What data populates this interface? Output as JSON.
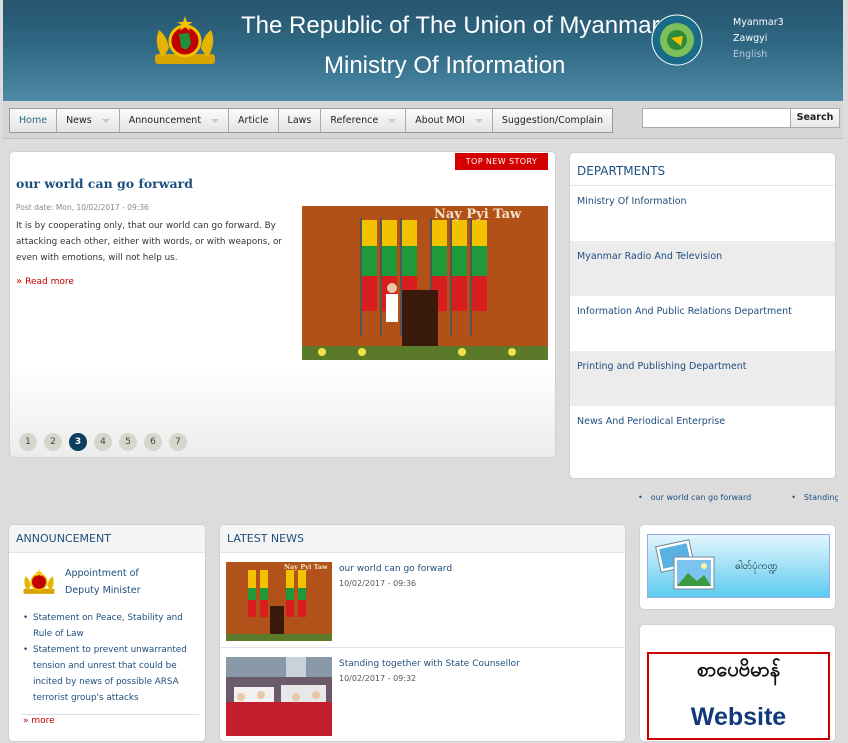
{
  "header": {
    "title_line1": "The Republic of The Union of Myanmar",
    "title_line2": "Ministry Of Information",
    "languages": [
      "Myanmar3",
      "Zawgyi",
      "English"
    ]
  },
  "nav": {
    "items": [
      {
        "label": "Home"
      },
      {
        "label": "News"
      },
      {
        "label": "Announcement"
      },
      {
        "label": "Article"
      },
      {
        "label": "Laws"
      },
      {
        "label": "Reference"
      },
      {
        "label": "About MOI"
      },
      {
        "label": "Suggestion/Complain"
      }
    ],
    "search_button": "Search",
    "search_value": ""
  },
  "featured": {
    "badge": "TOP NEW STORY",
    "title": "our world can go forward",
    "date": "Post date: Mon, 10/02/2017 - 09:36",
    "body": "It is by cooperating only, that our world can go forward. By attacking each other, either with words, or with weapons, or even with emotions, will not help us.",
    "more_arrow": "»",
    "read_more": "Read more",
    "image_caption": "Nay Pyi Taw",
    "pages": [
      "1",
      "2",
      "3",
      "4",
      "5",
      "6",
      "7"
    ],
    "current_page": "3"
  },
  "departments": {
    "heading": "DEPARTMENTS",
    "items": [
      "Ministry Of Information",
      "Myanmar Radio And Television",
      "Information And Public Relations Department",
      "Printing and Publishing Department",
      "News And Periodical Enterprise"
    ]
  },
  "ticker": [
    "our world can go forward",
    "Standing"
  ],
  "announcement": {
    "heading": "ANNOUNCEMENT",
    "feature_line1": "Appointment of",
    "feature_line2": "Deputy Minister",
    "items": [
      "Statement on Peace, Stability and Rule of Law",
      "Statement to prevent unwarranted tension and unrest that could be incited by news of possible ARSA terrorist group's attacks"
    ],
    "more": "more",
    "more_arrow": "»"
  },
  "latest_news": {
    "heading": "LATEST NEWS",
    "items": [
      {
        "title": "our world can go forward",
        "date": "10/02/2017 - 09:36",
        "caption": "Nay Pyi Taw"
      },
      {
        "title": "Standing together with State Counsellor",
        "date": "10/02/2017 - 09:32"
      }
    ]
  },
  "sidebar": {
    "gallery_label": "ဓါတ်ပုံကဏ္ဍ",
    "website_myanmar": "စာပေဗိမာန်",
    "website_english": "Website"
  },
  "colors": {
    "header_dark": "#26546d",
    "link_blue": "#1e4e7e",
    "accent_red": "#d40000",
    "pager_active": "#0e3e5e"
  },
  "icons": [
    "state-emblem-icon",
    "ministry-seal-icon",
    "dropdown-caret-icon",
    "double-chevron-icon",
    "photo-gallery-icon"
  ]
}
